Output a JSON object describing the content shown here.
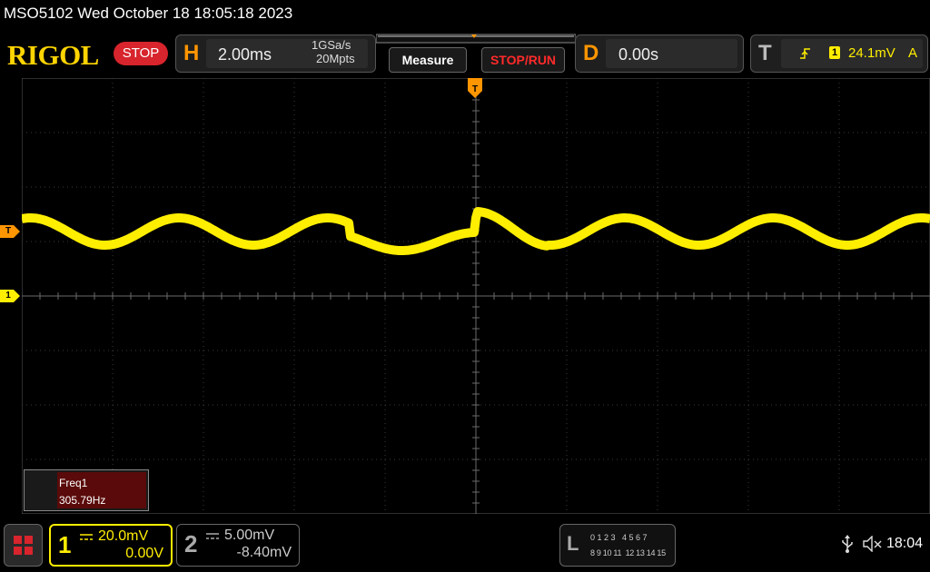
{
  "titlebar": {
    "text": "MSO5102  Wed October 18 18:05:18 2023"
  },
  "brand": {
    "logo": "RIGOL",
    "run_state": "STOP"
  },
  "horizontal": {
    "letter": "H",
    "timebase": "2.00ms",
    "sample_rate": "1GSa/s",
    "memory_depth": "20Mpts"
  },
  "buttons": {
    "measure": "Measure",
    "stop_run": "STOP/RUN"
  },
  "delay": {
    "letter": "D",
    "value": "0.00s"
  },
  "trigger": {
    "letter": "T",
    "source": "1",
    "level": "24.1mV",
    "mode": "A"
  },
  "markers": {
    "trigger_pos": "T",
    "trigger_level": "T",
    "channel1": "1"
  },
  "measurement": {
    "label": "Freq1",
    "value": "305.79Hz"
  },
  "channel1": {
    "number": "1",
    "scale": "20.0mV",
    "offset": "0.00V"
  },
  "channel2": {
    "number": "2",
    "scale": "5.00mV",
    "offset": "-8.40mV"
  },
  "logic": {
    "letter": "L",
    "row1": "0 1 2 3   4 5 6 7",
    "row2": "8 9 10 11  12 13 14 15"
  },
  "status": {
    "time": "18:04"
  },
  "colors": {
    "ch1": "#ffee00",
    "ch2": "#cccccc",
    "accent": "#ff9500",
    "stop": "#d8242c",
    "brand": "#ffd400"
  }
}
